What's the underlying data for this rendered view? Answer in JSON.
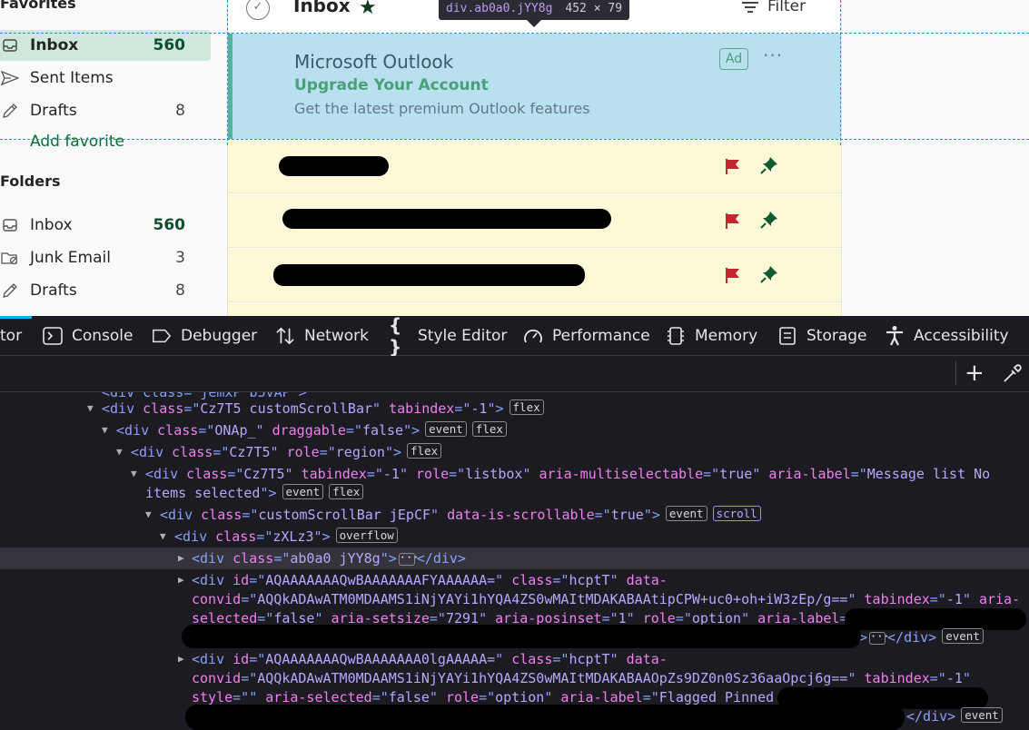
{
  "favorites": {
    "heading": "Favorites",
    "items": [
      {
        "label": "Inbox",
        "count": "560"
      },
      {
        "label": "Sent Items",
        "count": ""
      },
      {
        "label": "Drafts",
        "count": "8"
      }
    ],
    "add_label": "Add favorite"
  },
  "folders": {
    "heading": "Folders",
    "items": [
      {
        "label": "Inbox",
        "count": "560"
      },
      {
        "label": "Junk Email",
        "count": "3"
      },
      {
        "label": "Drafts",
        "count": "8"
      }
    ]
  },
  "mail_list": {
    "title": "Inbox",
    "filter_label": "Filter",
    "ad": {
      "from": "Microsoft Outlook",
      "subject": "Upgrade Your Account",
      "preview": "Get the latest premium Outlook features",
      "badge": "Ad",
      "more": "···"
    }
  },
  "highlighter": {
    "tag": "div",
    "selector": ".ab0a0.jYY8g",
    "dims": "452 × 79"
  },
  "devtools": {
    "tabs": [
      {
        "label": "tor",
        "icon": "inspector-icon"
      },
      {
        "label": "Console",
        "icon": "console-icon"
      },
      {
        "label": "Debugger",
        "icon": "debugger-icon"
      },
      {
        "label": "Network",
        "icon": "network-icon"
      },
      {
        "label": "Style Editor",
        "icon": "style-editor-icon"
      },
      {
        "label": "Performance",
        "icon": "performance-icon"
      },
      {
        "label": "Memory",
        "icon": "memory-icon"
      },
      {
        "label": "Storage",
        "icon": "storage-icon"
      },
      {
        "label": "Accessibility",
        "icon": "accessibility-icon"
      }
    ],
    "nodes": {
      "n1": {
        "class": "Cz7T5 customScrollBar",
        "tabindex": "-1",
        "badges": [
          "flex"
        ]
      },
      "n2": {
        "class": "ONAp_",
        "draggable": "false",
        "badges": [
          "event",
          "flex"
        ]
      },
      "n3": {
        "class": "Cz7T5",
        "role": "region",
        "badges": [
          "flex"
        ]
      },
      "n4": {
        "class": "Cz7T5",
        "tabindex": "-1",
        "role": "listbox",
        "aria_multiselectable": "true",
        "aria_label": "Message list No",
        "aria_label_cont": "items selected",
        "badges": [
          "event",
          "flex"
        ]
      },
      "n5": {
        "class": "customScrollBar jEpCF",
        "data_is_scrollable": "true",
        "badges": [
          "event",
          "scroll"
        ]
      },
      "n6": {
        "class": "zXLz3",
        "badges": [
          "overflow"
        ]
      },
      "n7": {
        "class": "ab0a0 jYY8g"
      },
      "n8": {
        "id": "AQAAAAAAAQwBAAAAAAAFYAAAAAA=",
        "class": "hcptT",
        "convid": "AQQkADAwATM0MDAAMS1iNjYAYi1hYQA4ZS0wMAItMDAKABAAtipCPW+uc0+oh+iW3zEp/g==",
        "tabindex": "-1",
        "aria_selected": "false",
        "aria_setsize": "7291",
        "aria_posinset": "1",
        "role": "option",
        "badges": [
          "event"
        ]
      },
      "n9": {
        "id": "AQAAAAAAAQwBAAAAAAA0lgAAAAA=",
        "class": "hcptT",
        "convid": "AQQkADAwATM0MDAAMS1iNjYAYi1hYQA4ZS0wMAItMDAKABAAOpZs9DZ0n0Sz36aaOpcj6g==",
        "tabindex": "-1",
        "style": "",
        "aria_selected": "false",
        "role": "option",
        "aria_label": "Flagged Pinned",
        "badges": [
          "event"
        ]
      }
    }
  }
}
